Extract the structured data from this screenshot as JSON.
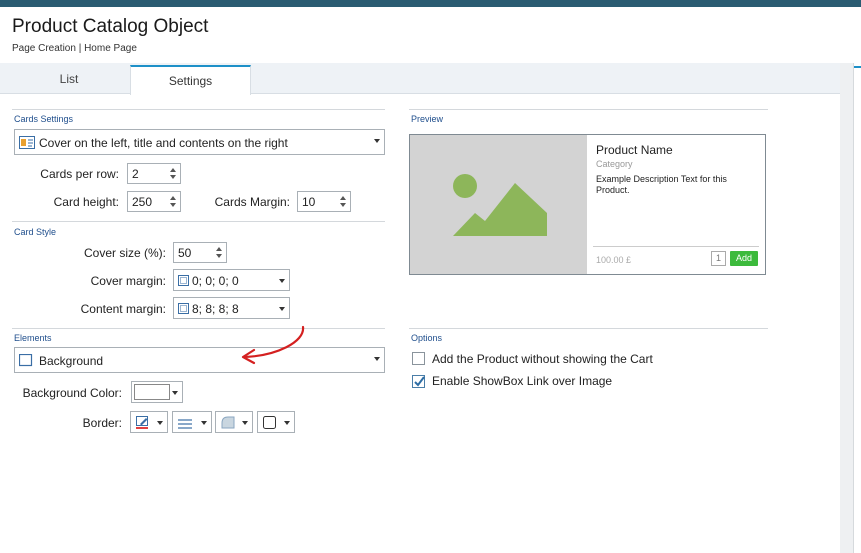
{
  "header": {
    "title": "Product Catalog Object",
    "breadcrumb": "Page Creation | Home Page"
  },
  "tabs": [
    {
      "label": "List"
    },
    {
      "label": "Settings"
    }
  ],
  "cards_settings": {
    "section_label": "Cards Settings",
    "layout_value": "Cover on the left, title and contents on the right",
    "cards_per_row_label": "Cards per row:",
    "cards_per_row_value": "2",
    "card_height_label": "Card height:",
    "card_height_value": "250",
    "cards_margin_label": "Cards Margin:",
    "cards_margin_value": "10"
  },
  "card_style": {
    "section_label": "Card Style",
    "cover_size_label": "Cover size (%):",
    "cover_size_value": "50",
    "cover_margin_label": "Cover margin:",
    "cover_margin_value": "0; 0; 0; 0",
    "content_margin_label": "Content margin:",
    "content_margin_value": "8; 8; 8; 8"
  },
  "elements": {
    "section_label": "Elements",
    "selected_element": "Background",
    "background_color_label": "Background Color:",
    "background_color_value": "#ffffff",
    "border_label": "Border:"
  },
  "preview": {
    "section_label": "Preview",
    "product_name": "Product Name",
    "category": "Category",
    "description": "Example Description Text for this Product.",
    "price": "100.00 £",
    "quantity": "1",
    "add_label": "Add",
    "image_bg_color": "#d3d3d3",
    "image_icon_color": "#8db65a"
  },
  "options": {
    "section_label": "Options",
    "items": [
      {
        "label": "Add the Product without showing the Cart",
        "checked": false
      },
      {
        "label": "Enable ShowBox Link over Image",
        "checked": true
      }
    ]
  },
  "colors": {
    "accent": "#1e90c8",
    "topbar": "#2a5c72",
    "section_heading": "#1f4e8c",
    "annotation_highlight": "#f2f20a",
    "annotation_arrow": "#d42020"
  }
}
